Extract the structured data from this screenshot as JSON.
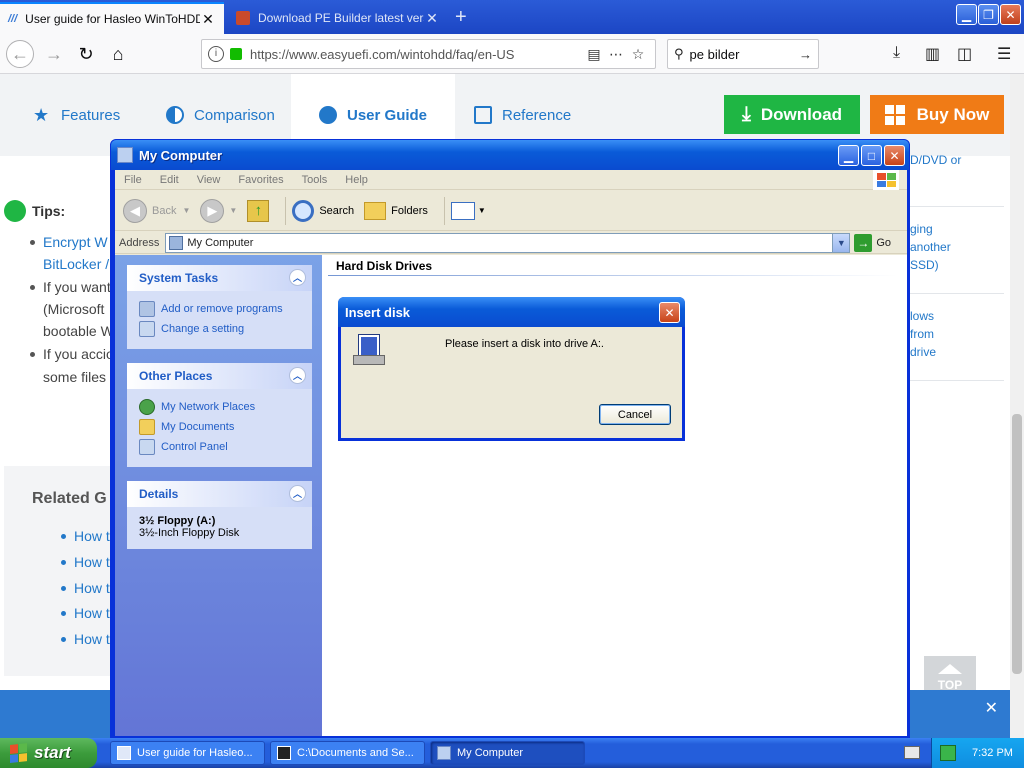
{
  "browser": {
    "tabs": [
      {
        "title": "User guide for Hasleo WinToHDD",
        "active": true
      },
      {
        "title": "Download PE Builder latest version",
        "active": false
      }
    ],
    "url": "https://www.easyuefi.com/wintohdd/faq/en-US",
    "search_text": "pe bilder"
  },
  "site": {
    "nav": [
      "Features",
      "Comparison",
      "User Guide",
      "Reference"
    ],
    "download_label": "Download",
    "buy_label": "Buy Now",
    "tips_label": "Tips:",
    "tip_lines": [
      "Encrypt W",
      "BitLocker /",
      "If you want",
      "(Microsoft",
      "bootable W",
      "If you accio",
      "some files"
    ],
    "related_title": "Related G",
    "related_links": [
      "How t",
      "How t",
      "How t",
      "How t",
      "How t"
    ],
    "right_snippets": [
      "D/DVD or",
      "ging",
      "another",
      "SSD)",
      "lows",
      "from",
      "drive"
    ],
    "top_label": "TOP"
  },
  "window": {
    "title": "My Computer",
    "menu": [
      "File",
      "Edit",
      "View",
      "Favorites",
      "Tools",
      "Help"
    ],
    "toolbar": {
      "back": "Back",
      "search": "Search",
      "folders": "Folders"
    },
    "address_label": "Address",
    "address_value": "My Computer",
    "go_label": "Go",
    "system_tasks": {
      "title": "System Tasks",
      "items": [
        "Add or remove programs",
        "Change a setting"
      ]
    },
    "other_places": {
      "title": "Other Places",
      "items": [
        "My Network Places",
        "My Documents",
        "Control Panel"
      ]
    },
    "details": {
      "title": "Details",
      "name": "3½ Floppy (A:)",
      "type": "3½-Inch Floppy Disk"
    },
    "group_header": "Hard Disk Drives"
  },
  "dialog": {
    "title": "Insert disk",
    "message": "Please insert a disk into drive A:.",
    "cancel_label": "Cancel"
  },
  "taskbar": {
    "start_label": "start",
    "tasks": [
      "User guide for Hasleo...",
      "C:\\Documents and Se...",
      "My Computer"
    ],
    "clock": "7:32 PM"
  }
}
